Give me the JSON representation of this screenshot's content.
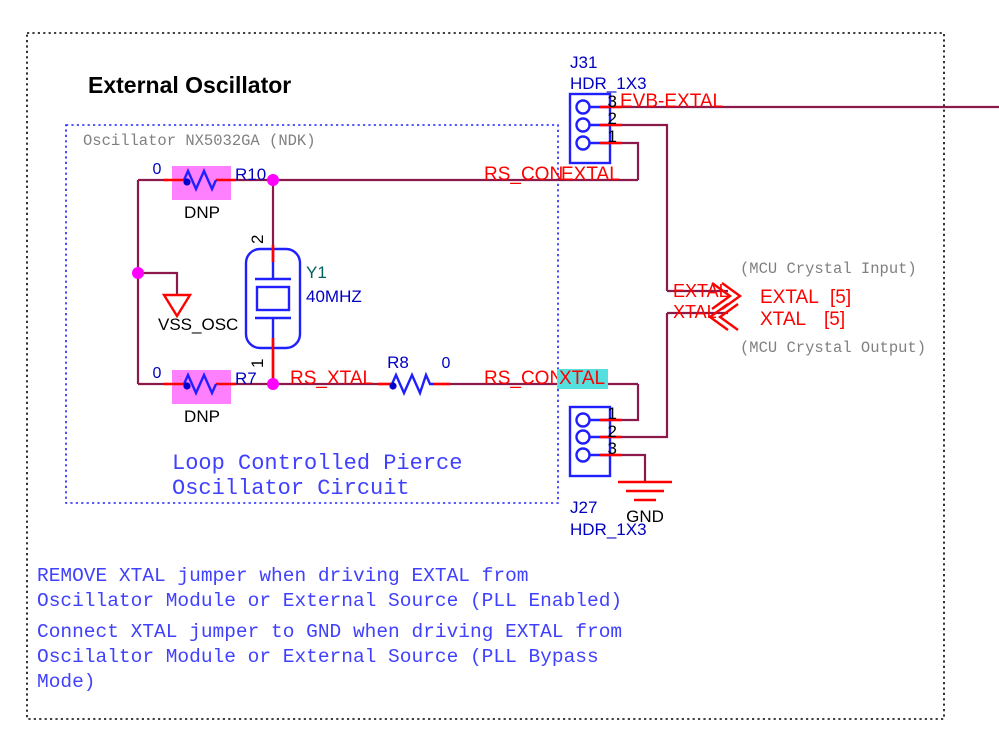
{
  "sheet": {
    "title": "External Oscillator",
    "inner_box_caption": "Oscillator NX5032GA (NDK)",
    "inner_box_note_line1": "Loop Controlled Pierce",
    "inner_box_note_line2": "Oscillator Circuit"
  },
  "components": {
    "r10": {
      "ref": "R10",
      "value": "0",
      "note": "DNP"
    },
    "r7": {
      "ref": "R7",
      "value": "0",
      "note": "DNP"
    },
    "r8": {
      "ref": "R8",
      "value": "0"
    },
    "y1": {
      "ref": "Y1",
      "value": "40MHZ",
      "pin1": "1",
      "pin2": "2"
    },
    "vss_osc": {
      "label": "VSS_OSC"
    },
    "gnd": {
      "label": "GND"
    },
    "j31": {
      "ref": "J31",
      "type": "HDR_1X3",
      "pins": [
        "3",
        "2",
        "1"
      ]
    },
    "j27": {
      "ref": "J27",
      "type": "HDR_1X3",
      "pins": [
        "1",
        "2",
        "3"
      ]
    }
  },
  "nets": {
    "evb_extal": "EVB-EXTAL",
    "rs_con_extal_a": "RS_CON",
    "rs_con_extal_b": "EXTAL",
    "rs_xtal": "RS_XTAL",
    "rs_con_xtal_a": "RS_CON",
    "rs_con_xtal_b": "XTAL"
  },
  "port": {
    "label_top": "EXTAL",
    "label_bottom": "XTAL",
    "name_top": "EXTAL",
    "name_bottom": "XTAL",
    "ref_top": "[5]",
    "ref_bottom": "[5]",
    "comment_top": "(MCU Crystal Input)",
    "comment_bottom": "(MCU Crystal Output)"
  },
  "notes": {
    "line1": "REMOVE XTAL jumper when driving EXTAL from",
    "line2": "Oscillator Module or External Source (PLL Enabled)",
    "line3": "Connect XTAL jumper to GND when driving EXTAL from",
    "line4": "Oscilaltor Module or External Source (PLL Bypass",
    "line5": "Mode)"
  },
  "colors": {
    "wire": "#8b1a4a",
    "pin_lead": "#ff0000",
    "symbol_blue": "#2020ff",
    "junction": "#ff00ff",
    "highlight_pink": "#ff80ff",
    "highlight_cyan": "#55e0e0",
    "net_label": "#ff0000",
    "note_text": "#4040ff",
    "caption_gray": "#808080"
  }
}
